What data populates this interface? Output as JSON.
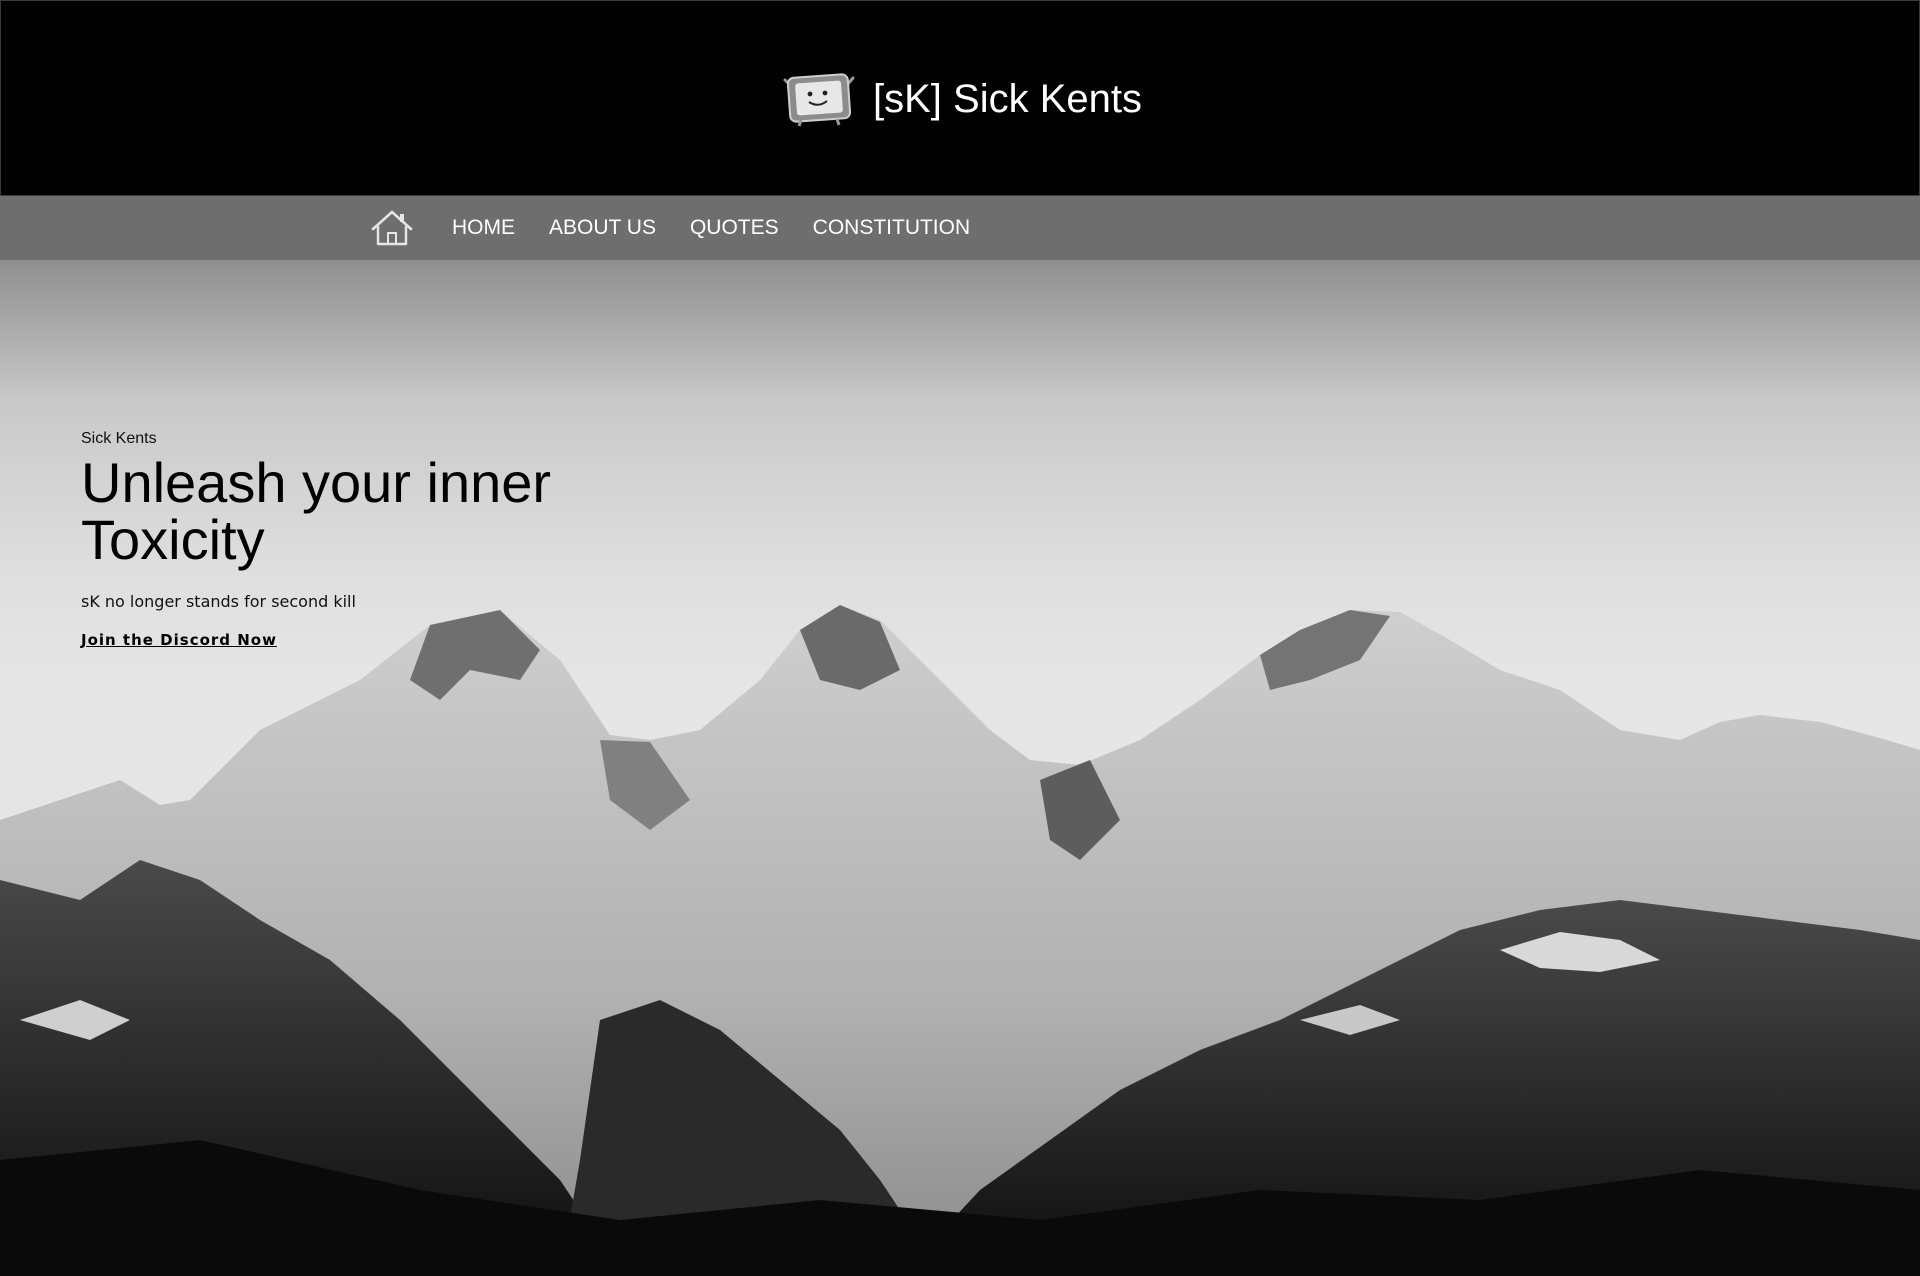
{
  "header": {
    "title": "[sK] Sick Kents",
    "logo_icon": "tv-mascot-icon"
  },
  "nav": {
    "home_icon": "house-icon",
    "items": [
      {
        "label": "HOME"
      },
      {
        "label": "ABOUT US"
      },
      {
        "label": "QUOTES"
      },
      {
        "label": "CONSTITUTION"
      }
    ]
  },
  "hero": {
    "eyebrow": "Sick Kents",
    "headline_line1": "Unleash your inner",
    "headline_line2": "Toxicity",
    "tagline": "sK no longer stands for second kill",
    "cta_label": "Join the Discord Now"
  },
  "colors": {
    "header_bg": "#000000",
    "nav_bg": "#6e6e6e",
    "nav_text": "#ffffff",
    "hero_text": "#000000"
  }
}
